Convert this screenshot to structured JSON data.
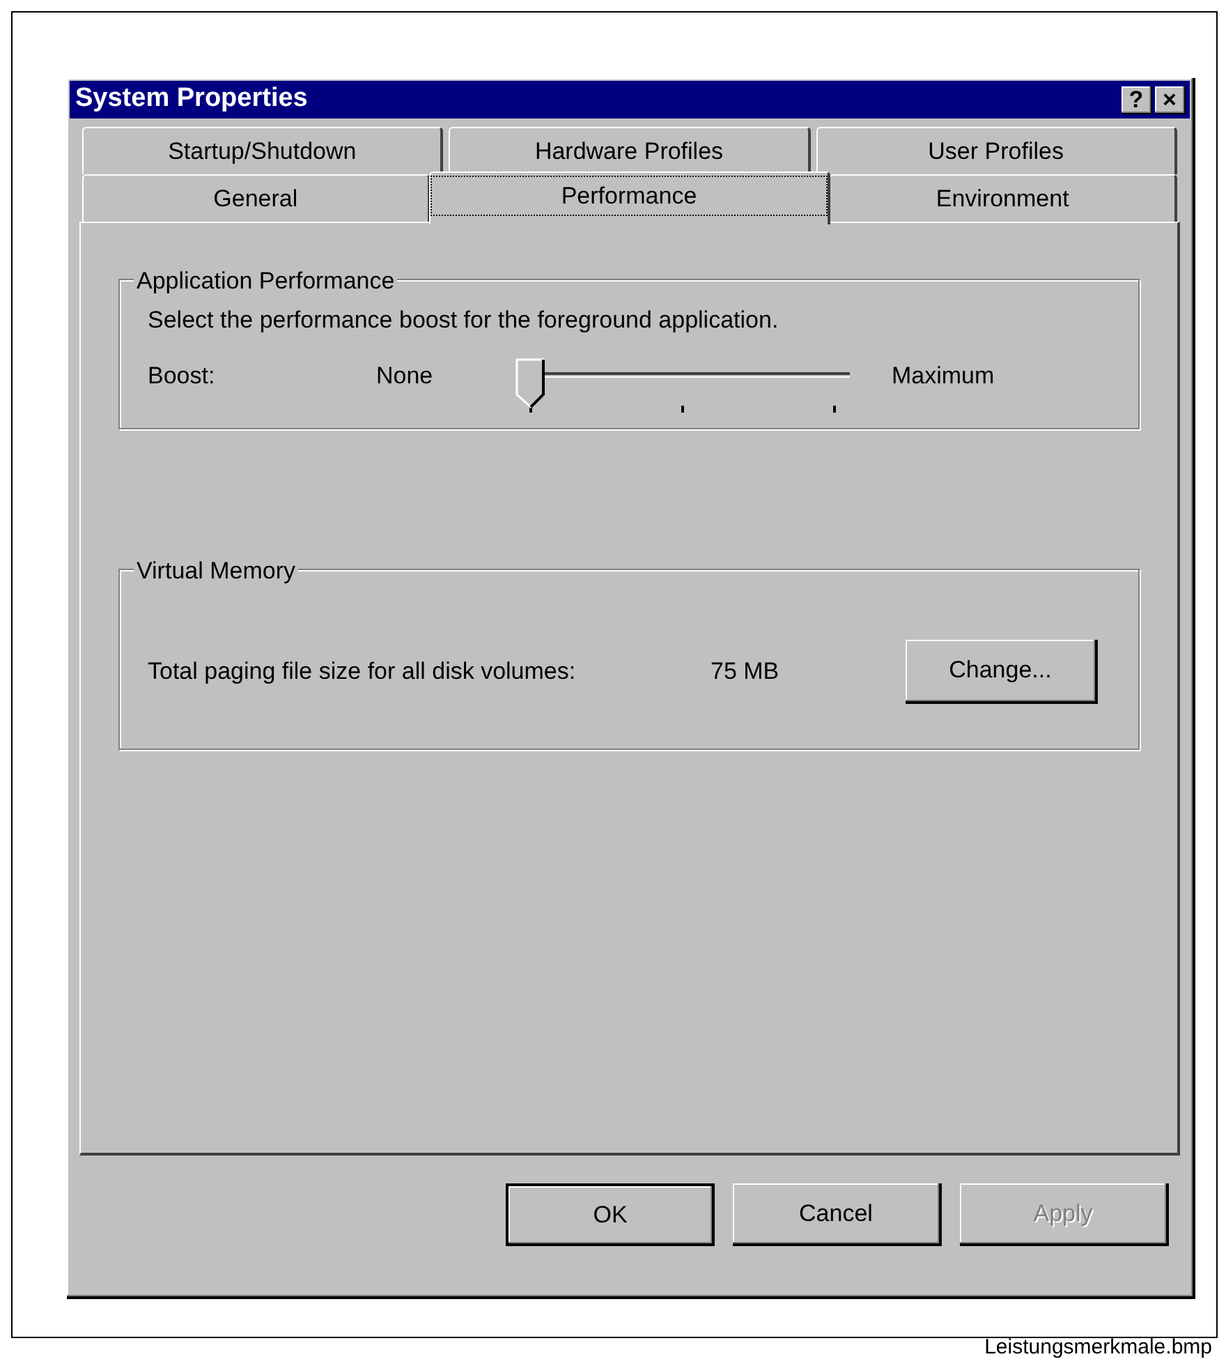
{
  "window": {
    "title": "System Properties",
    "title_buttons": [
      "?",
      "×"
    ]
  },
  "tabs": [
    [
      {
        "label": "Startup/Shutdown",
        "selected": false
      },
      {
        "label": "Hardware Profiles",
        "selected": false
      },
      {
        "label": "User Profiles",
        "selected": false
      }
    ],
    [
      {
        "label": "General",
        "selected": false
      },
      {
        "label": "Performance",
        "selected": true
      },
      {
        "label": "Environment",
        "selected": false
      }
    ]
  ],
  "application_performance": {
    "title": "Application Performance",
    "description": "Select the performance boost for the foreground application.",
    "boost": {
      "label": "Boost:",
      "min_label": "None",
      "max_label": "Maximum",
      "level": 0
    }
  },
  "virtual_memory": {
    "title": "Virtual Memory",
    "label": "Total paging file size for all disk volumes:",
    "value": "75 MB",
    "button": "Change..."
  },
  "buttons": [
    {
      "label": "OK",
      "default": true,
      "disabled": false
    },
    {
      "label": "Cancel",
      "default": false,
      "disabled": false
    },
    {
      "label": "Apply",
      "default": false,
      "disabled": true
    }
  ],
  "caption": "Leistungsmerkmale.bmp"
}
